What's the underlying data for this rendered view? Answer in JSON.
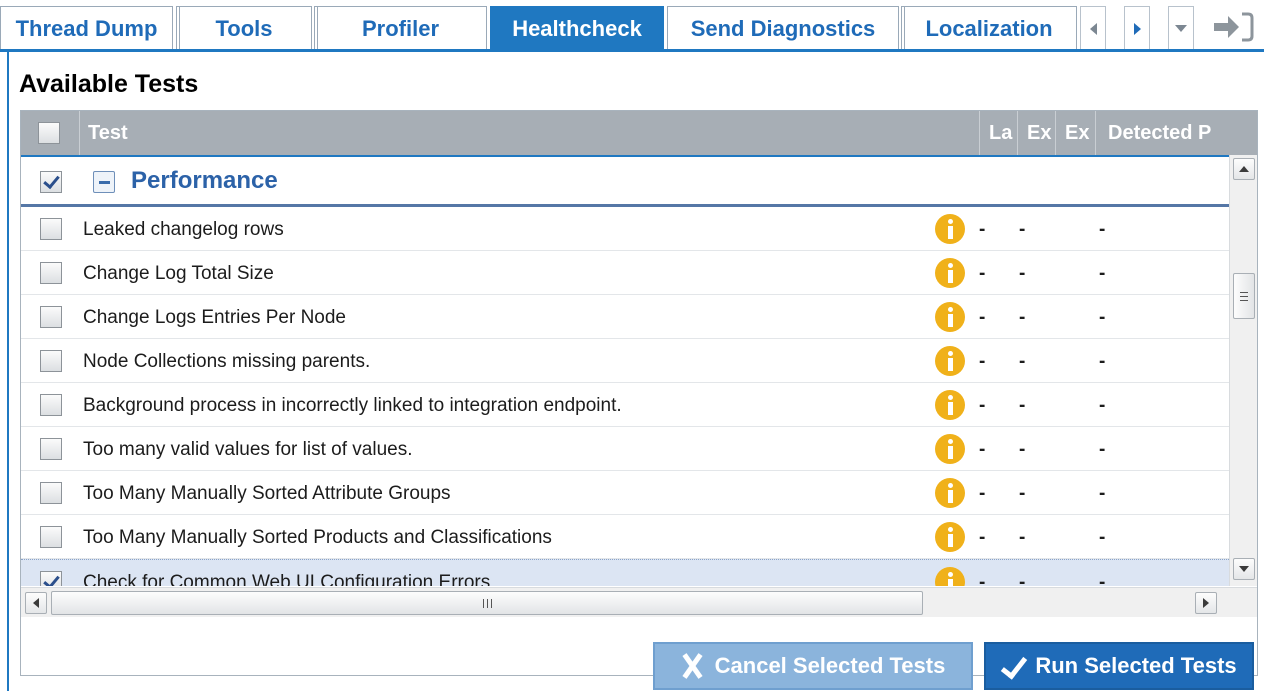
{
  "tabs": [
    {
      "label": "Thread Dump",
      "active": false
    },
    {
      "label": "Tools",
      "active": false
    },
    {
      "label": "Profiler",
      "active": false
    },
    {
      "label": "Healthcheck",
      "active": true
    },
    {
      "label": "Send Diagnostics",
      "active": false
    },
    {
      "label": "Localization",
      "active": false
    }
  ],
  "tab_controls": [
    "scroll-left-icon",
    "scroll-right-icon",
    "tab-menu-icon",
    "exit-icon"
  ],
  "section_title": "Available Tests",
  "grid": {
    "columns": [
      "Test",
      "La",
      "Ex",
      "Ex",
      "Detected P"
    ],
    "group": {
      "label": "Performance",
      "checked": true,
      "expanded": true
    },
    "rows": [
      {
        "name": "Leaked changelog rows",
        "checked": false,
        "c1": "-",
        "c2": "-",
        "c3": "-"
      },
      {
        "name": "Change Log Total Size",
        "checked": false,
        "c1": "-",
        "c2": "-",
        "c3": "-"
      },
      {
        "name": "Change Logs Entries Per Node",
        "checked": false,
        "c1": "-",
        "c2": "-",
        "c3": "-"
      },
      {
        "name": "Node Collections missing parents.",
        "checked": false,
        "c1": "-",
        "c2": "-",
        "c3": "-"
      },
      {
        "name": "Background process in incorrectly linked to integration endpoint.",
        "checked": false,
        "c1": "-",
        "c2": "-",
        "c3": "-"
      },
      {
        "name": "Too many valid values for list of values.",
        "checked": false,
        "c1": "-",
        "c2": "-",
        "c3": "-"
      },
      {
        "name": "Too Many Manually Sorted Attribute Groups",
        "checked": false,
        "c1": "-",
        "c2": "-",
        "c3": "-"
      },
      {
        "name": "Too Many Manually Sorted Products and Classifications",
        "checked": false,
        "c1": "-",
        "c2": "-",
        "c3": "-"
      },
      {
        "name": "Check for Common Web UI Configuration Errors",
        "checked": true,
        "selected": true,
        "c1": "-",
        "c2": "-",
        "c3": "-"
      }
    ]
  },
  "buttons": {
    "cancel": "Cancel Selected Tests",
    "run": "Run Selected Tests"
  },
  "colors": {
    "accent": "#1f78c1",
    "header_bg": "#a7aeb5",
    "info_icon": "#f0b11a",
    "cancel_bg": "#8bb4dc",
    "run_bg": "#1f6bb8"
  }
}
